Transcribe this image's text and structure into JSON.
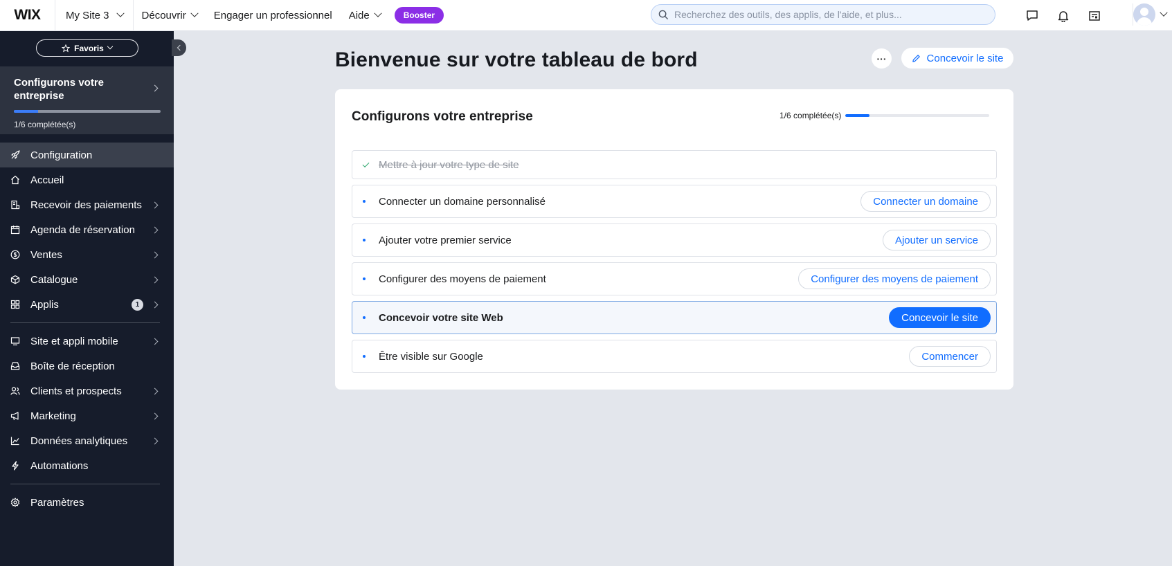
{
  "topbar": {
    "logo": "WIX",
    "site_name": "My Site 3",
    "nav": [
      {
        "label": "Découvrir"
      },
      {
        "label": "Engager un professionnel"
      },
      {
        "label": "Aide"
      }
    ],
    "booster_label": "Booster",
    "search_placeholder": "Recherchez des outils, des applis, de l'aide, et plus...",
    "icons": [
      "chat-icon",
      "bell-icon",
      "news-icon",
      "avatar"
    ]
  },
  "sidebar": {
    "favorites_label": "Favoris",
    "setup": {
      "title": "Configurons votre entreprise",
      "progress_text": "1/6 complétée(s)",
      "progress_fraction": 0.1667
    },
    "menu_group_1": [
      {
        "label": "Configuration",
        "icon": "rocket-icon",
        "active": true,
        "chevron": false
      },
      {
        "label": "Accueil",
        "icon": "home-icon",
        "chevron": false
      },
      {
        "label": "Recevoir des paiements",
        "icon": "payment-icon",
        "chevron": true
      },
      {
        "label": "Agenda de réservation",
        "icon": "calendar-icon",
        "chevron": true
      },
      {
        "label": "Ventes",
        "icon": "dollar-icon",
        "chevron": true
      },
      {
        "label": "Catalogue",
        "icon": "catalog-icon",
        "chevron": true
      },
      {
        "label": "Applis",
        "icon": "apps-icon",
        "chevron": true,
        "badge": "1"
      }
    ],
    "menu_group_2": [
      {
        "label": "Site et appli mobile",
        "icon": "site-icon",
        "chevron": true
      },
      {
        "label": "Boîte de réception",
        "icon": "inbox-icon",
        "chevron": false
      },
      {
        "label": "Clients et prospects",
        "icon": "contacts-icon",
        "chevron": true
      },
      {
        "label": "Marketing",
        "icon": "megaphone-icon",
        "chevron": true
      },
      {
        "label": "Données analytiques",
        "icon": "analytics-icon",
        "chevron": true
      },
      {
        "label": "Automations",
        "icon": "lightning-icon",
        "chevron": false
      }
    ],
    "menu_group_3": [
      {
        "label": "Paramètres",
        "icon": "gear-icon",
        "chevron": false
      }
    ]
  },
  "main": {
    "title": "Bienvenue sur votre tableau de bord",
    "design_button": "Concevoir le site",
    "card": {
      "title": "Configurons votre entreprise",
      "progress_text": "1/6 complétée(s)",
      "progress_fraction": 0.1667,
      "tasks": [
        {
          "label": "Mettre à jour votre type de site",
          "done": true,
          "button": ""
        },
        {
          "label": "Connecter un domaine personnalisé",
          "done": false,
          "button": "Connecter un domaine"
        },
        {
          "label": "Ajouter votre premier service",
          "done": false,
          "button": "Ajouter un service"
        },
        {
          "label": "Configurer des moyens de paiement",
          "done": false,
          "button": "Configurer des moyens de paiement"
        },
        {
          "label": "Concevoir votre site Web",
          "done": false,
          "button": "Concevoir le site",
          "highlight": true
        },
        {
          "label": "Être visible sur Google",
          "done": false,
          "button": "Commencer"
        }
      ]
    }
  },
  "colors": {
    "accent": "#116dff",
    "sidebar_bg": "#161c2b",
    "booster": "#8b2ee6",
    "page_bg": "#e3e6ec"
  }
}
